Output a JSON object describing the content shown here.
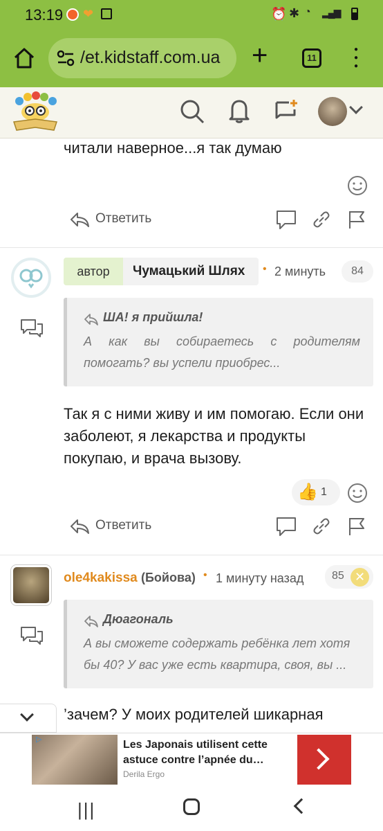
{
  "status_bar": {
    "time": "13:19"
  },
  "browser": {
    "url": "/et.kidstaff.com.ua",
    "tab_count": "11"
  },
  "comments": [
    {
      "text_tail": "читали наверное...я так думаю",
      "reply_label": "Ответить"
    },
    {
      "role_badge": "автор",
      "author": "Чумацький Шлях",
      "time": "2 минуть",
      "counter": "84",
      "quote_author": "ША! я прийшла!",
      "quote_text": "А как вы собираетесь с родителям помогать? вы успели приобрес...",
      "text": "Так я с ними живу и им помогаю. Если они заболеют, я лекарства и продукты покупаю, и врача вызову.",
      "likes": "1",
      "reply_label": "Ответить"
    },
    {
      "author": "ole4kakissa",
      "author_note": "(Бойова)",
      "time": "1 минуту назад",
      "counter": "85",
      "quote_author": "Дюагональ",
      "quote_text": "А вы сможете содержать ребёнка лет хотя бы 40? У вас уже есть квартира, своя, вы ...",
      "text_partial": "’зачем? У моих родителей шикарная"
    }
  ],
  "ad": {
    "title": "Les Japonais utilisent cette astuce contre l’apnée du…",
    "source": "Derila Ergo"
  },
  "colors": {
    "brand_green": "#8dbf43",
    "orange": "#e08a1e",
    "author_bg": "#e4f2cf"
  }
}
